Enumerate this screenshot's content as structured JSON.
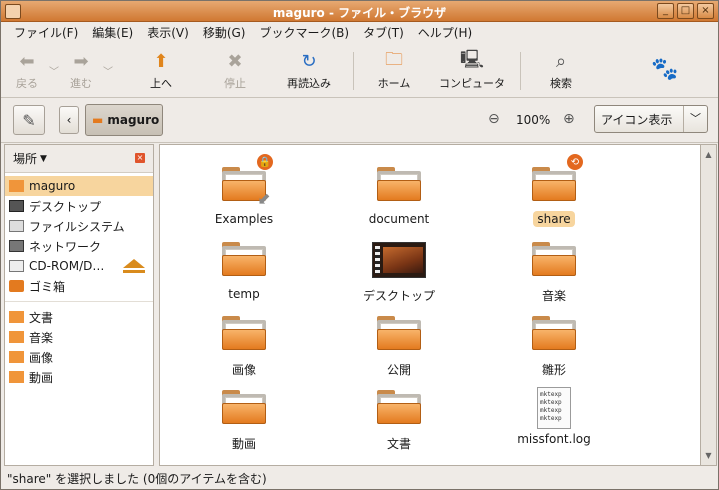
{
  "window": {
    "title": "maguro - ファイル・ブラウザ"
  },
  "menubar": [
    "ファイル(F)",
    "編集(E)",
    "表示(V)",
    "移動(G)",
    "ブックマーク(B)",
    "タブ(T)",
    "ヘルプ(H)"
  ],
  "toolbar": {
    "back": "戻る",
    "forward": "進む",
    "up": "上へ",
    "stop": "停止",
    "reload": "再読込み",
    "home": "ホーム",
    "computer": "コンピュータ",
    "search": "検索"
  },
  "location": {
    "path_button": "maguro",
    "zoom": "100%",
    "view_mode": "アイコン表示"
  },
  "sidebar": {
    "header": "場所",
    "places": [
      "maguro",
      "デスクトップ",
      "ファイルシステム",
      "ネットワーク",
      "CD-ROM/D…",
      "ゴミ箱"
    ],
    "bookmarks": [
      "文書",
      "音楽",
      "画像",
      "動画"
    ]
  },
  "files": [
    {
      "name": "Examples",
      "type": "folder",
      "emblem": "lock-icon",
      "link": true
    },
    {
      "name": "document",
      "type": "folder"
    },
    {
      "name": "share",
      "type": "folder",
      "emblem": "sync-icon",
      "selected": true
    },
    {
      "name": "temp",
      "type": "folder"
    },
    {
      "name": "デスクトップ",
      "type": "desktop"
    },
    {
      "name": "音楽",
      "type": "folder"
    },
    {
      "name": "画像",
      "type": "folder"
    },
    {
      "name": "公開",
      "type": "folder"
    },
    {
      "name": "雛形",
      "type": "folder"
    },
    {
      "name": "動画",
      "type": "folder"
    },
    {
      "name": "文書",
      "type": "folder"
    },
    {
      "name": "missfont.log",
      "type": "text",
      "preview": [
        "mktexp",
        "mktexp",
        "mktexp",
        "mktexp"
      ]
    }
  ],
  "status": "\"share\" を選択しました (0個のアイテムを含む)",
  "colors": {
    "titlebar": "#d07832",
    "selection": "#f7d59e",
    "folder": "#f0953a"
  }
}
